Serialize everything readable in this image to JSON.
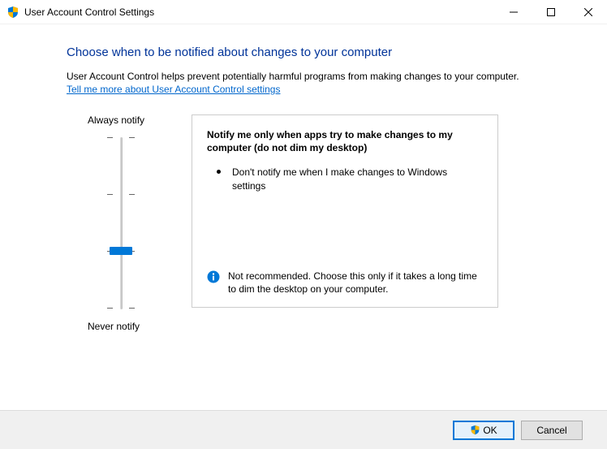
{
  "window": {
    "title": "User Account Control Settings"
  },
  "heading": "Choose when to be notified about changes to your computer",
  "description": "User Account Control helps prevent potentially harmful programs from making changes to your computer.",
  "link": "Tell me more about User Account Control settings",
  "slider": {
    "top_label": "Always notify",
    "bottom_label": "Never notify",
    "position": 2,
    "steps": 4
  },
  "panel": {
    "title": "Notify me only when apps try to make changes to my computer (do not dim my desktop)",
    "bullet": "Don't notify me when I make changes to Windows settings",
    "info": "Not recommended. Choose this only if it takes a long time to dim the desktop on your computer."
  },
  "buttons": {
    "ok": "OK",
    "cancel": "Cancel"
  }
}
